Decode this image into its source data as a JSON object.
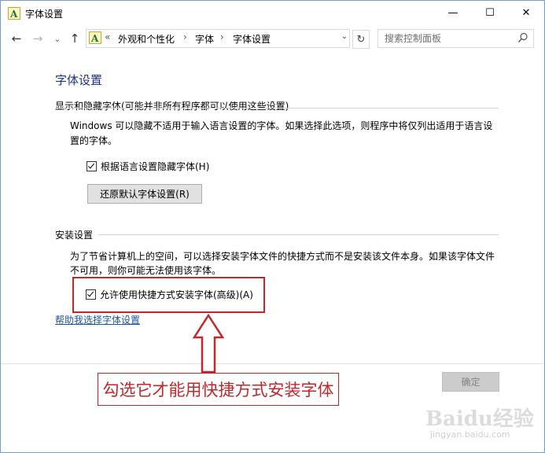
{
  "window": {
    "title": "字体设置",
    "minimize": "—",
    "maximize": "☐",
    "close": "✕"
  },
  "nav": {
    "back": "←",
    "forward": "→",
    "recent": "⌄",
    "up": "↑"
  },
  "address": {
    "chevrons": "«",
    "crumbs": [
      "外观和个性化",
      "字体",
      "字体设置"
    ],
    "sep": "›",
    "dropdown": "⌄",
    "refresh": "↻"
  },
  "search": {
    "placeholder": "搜索控制面板"
  },
  "content": {
    "title": "字体设置",
    "section1": {
      "heading": "显示和隐藏字体(可能并非所有程序都可以使用这些设置)",
      "para_line1": "Windows 可以隐藏不适用于输入语言设置的字体。如果选择此选项，则程序中将仅列出适用于语言设",
      "para_line2": "置的字体。",
      "checkbox_label": "根据语言设置隐藏字体(H)",
      "checkbox_checked": true,
      "restore_button": "还原默认字体设置(R)"
    },
    "section2": {
      "heading": "安装设置",
      "para_line1": "为了节省计算机上的空间，可以选择安装字体文件的快捷方式而不是安装该文件本身。如果该字体文件",
      "para_line2": "不可用，则你可能无法使用该字体。",
      "checkbox_label": "允许使用快捷方式安装字体(高级)(A)",
      "checkbox_checked": true
    },
    "help_link": "帮助我选择字体设置",
    "ok_button": "确定"
  },
  "annotation": {
    "callout_text": "勾选它才能用快捷方式安装字体",
    "color": "#c0282d"
  },
  "watermark": {
    "brand": "Baidu经验",
    "url": "jingyan.baidu.com"
  }
}
